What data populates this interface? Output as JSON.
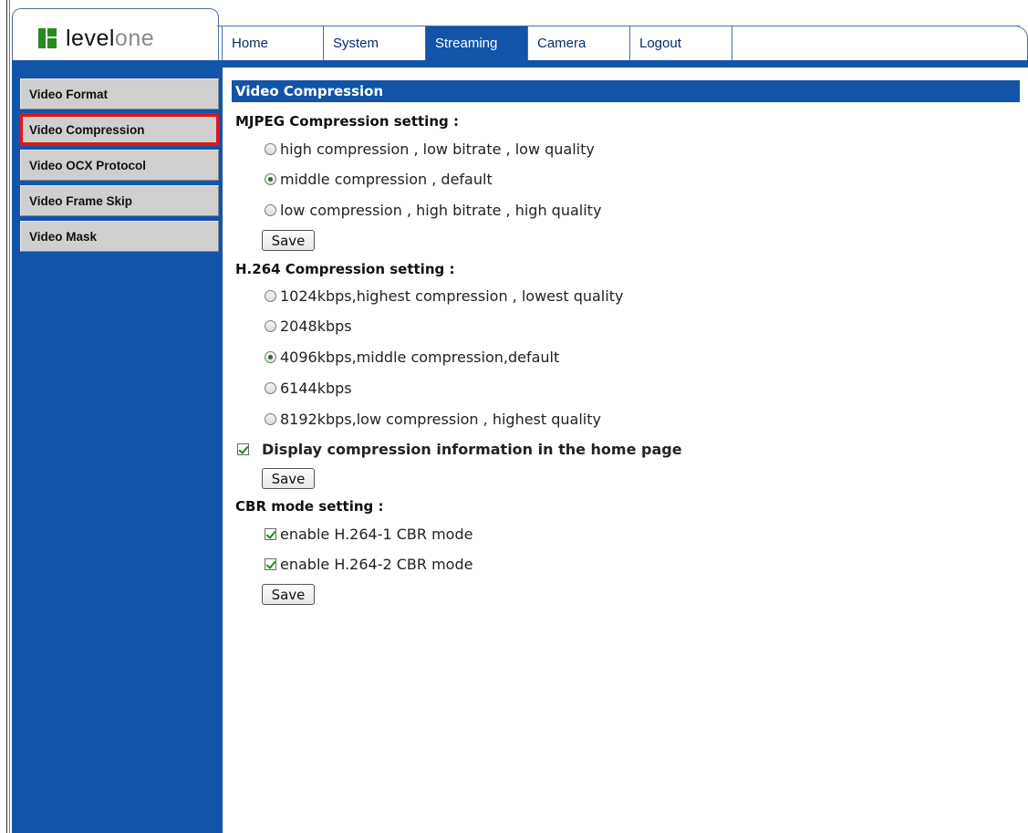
{
  "logo": {
    "text_main": "level",
    "text_one": "one"
  },
  "nav": {
    "tabs": [
      {
        "label": "Home",
        "active": false
      },
      {
        "label": "System",
        "active": false
      },
      {
        "label": "Streaming",
        "active": true
      },
      {
        "label": "Camera",
        "active": false
      },
      {
        "label": "Logout",
        "active": false
      }
    ]
  },
  "sidebar": {
    "items": [
      {
        "label": "Video Format"
      },
      {
        "label": "Video Compression",
        "selected": true
      },
      {
        "label": "Video OCX Protocol"
      },
      {
        "label": "Video Frame Skip"
      },
      {
        "label": "Video Mask"
      }
    ]
  },
  "main": {
    "section_title": "Video Compression",
    "mjpeg": {
      "heading": "MJPEG Compression setting :",
      "options": [
        {
          "label": "high compression , low bitrate , low quality",
          "checked": false
        },
        {
          "label": "middle compression , default",
          "checked": true
        },
        {
          "label": "low compression , high bitrate , high quality",
          "checked": false
        }
      ],
      "save_label": "Save"
    },
    "h264": {
      "heading": "H.264 Compression setting :",
      "options": [
        {
          "label": "1024kbps,highest compression , lowest quality",
          "checked": false
        },
        {
          "label": "2048kbps",
          "checked": false
        },
        {
          "label": "4096kbps,middle compression,default",
          "checked": true
        },
        {
          "label": "6144kbps",
          "checked": false
        },
        {
          "label": "8192kbps,low compression , highest quality",
          "checked": false
        }
      ],
      "display_info_label": "Display compression information in the home page",
      "display_info_checked": true,
      "save_label": "Save"
    },
    "cbr": {
      "heading": "CBR mode setting :",
      "options": [
        {
          "label": "enable H.264-1 CBR mode",
          "checked": true
        },
        {
          "label": "enable H.264-2 CBR mode",
          "checked": true
        }
      ],
      "save_label": "Save"
    }
  },
  "colors": {
    "brand_blue": "#1154a8",
    "selected_outline": "#e0151a",
    "logo_green": "#2a8a1e"
  }
}
